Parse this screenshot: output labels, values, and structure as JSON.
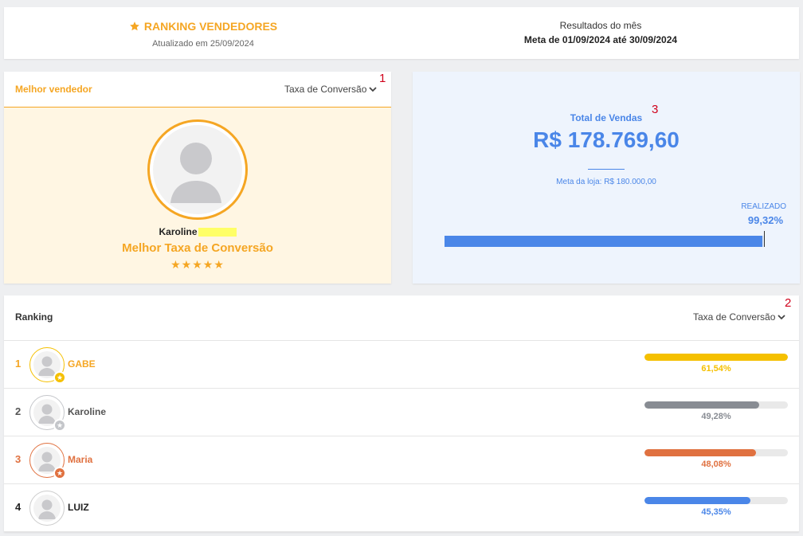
{
  "header": {
    "title": "RANKING VENDEDORES",
    "updated": "Atualizado em 25/09/2024",
    "results_label": "Resultados do mês",
    "meta_period": "Meta de 01/09/2024 até 30/09/2024"
  },
  "best_seller": {
    "label": "Melhor vendedor",
    "dropdown_label": "Taxa de Conversão",
    "marker": "1",
    "name": "Karoline",
    "metric_title": "Melhor Taxa de Conversão",
    "stars": "★★★★★"
  },
  "total_sales": {
    "marker": "3",
    "label": "Total de Vendas",
    "value": "R$ 178.769,60",
    "store_goal": "Meta da loja: R$ 180.000,00",
    "realized_label": "REALIZADO",
    "realized_pct": "99,32%",
    "realized_fraction": 0.9932
  },
  "ranking": {
    "title": "Ranking",
    "dropdown_label": "Taxa de Conversão",
    "marker": "2",
    "rows": [
      {
        "pos": "1",
        "name": "GABE",
        "pct": "61,54%",
        "fraction": 1.0,
        "color": "#f5c000",
        "medal": "gold"
      },
      {
        "pos": "2",
        "name": "Karoline",
        "pct": "49,28%",
        "fraction": 0.8,
        "color": "#888c93",
        "medal": "silver"
      },
      {
        "pos": "3",
        "name": "Maria",
        "pct": "48,08%",
        "fraction": 0.78,
        "color": "#e07140",
        "medal": "bronze"
      },
      {
        "pos": "4",
        "name": "LUIZ",
        "pct": "45,35%",
        "fraction": 0.74,
        "color": "#4a86e8",
        "medal": "none"
      }
    ]
  },
  "colors": {
    "accent": "#f5a623",
    "blue": "#4a86e8",
    "marker_red": "#d0021b"
  }
}
